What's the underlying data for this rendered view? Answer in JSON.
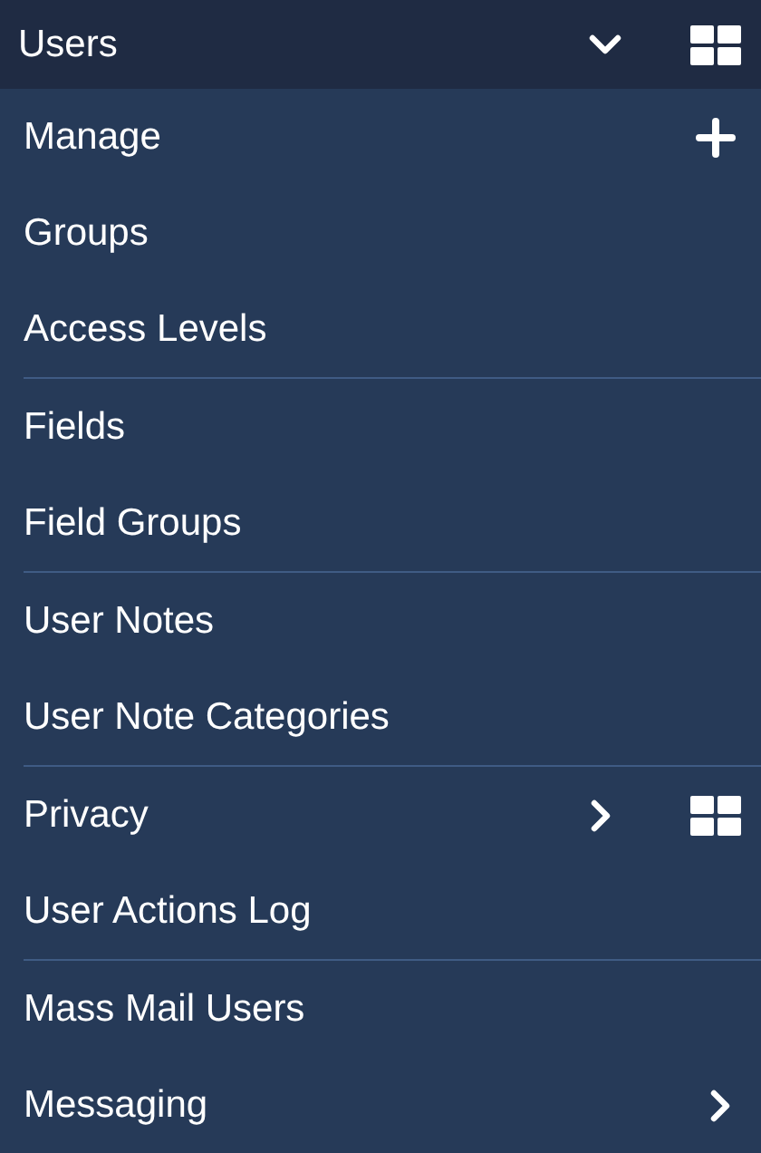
{
  "header": {
    "title": "Users",
    "expanded": true
  },
  "groups": [
    {
      "items": [
        {
          "label": "Manage",
          "kind": "add"
        },
        {
          "label": "Groups",
          "kind": "plain"
        },
        {
          "label": "Access Levels",
          "kind": "plain"
        }
      ]
    },
    {
      "items": [
        {
          "label": "Fields",
          "kind": "plain"
        },
        {
          "label": "Field Groups",
          "kind": "plain"
        }
      ]
    },
    {
      "items": [
        {
          "label": "User Notes",
          "kind": "plain"
        },
        {
          "label": "User Note Categories",
          "kind": "plain"
        }
      ]
    },
    {
      "items": [
        {
          "label": "Privacy",
          "kind": "submenu_dashboard"
        },
        {
          "label": "User Actions Log",
          "kind": "plain"
        }
      ]
    },
    {
      "items": [
        {
          "label": "Mass Mail Users",
          "kind": "plain"
        },
        {
          "label": "Messaging",
          "kind": "submenu"
        }
      ]
    }
  ]
}
